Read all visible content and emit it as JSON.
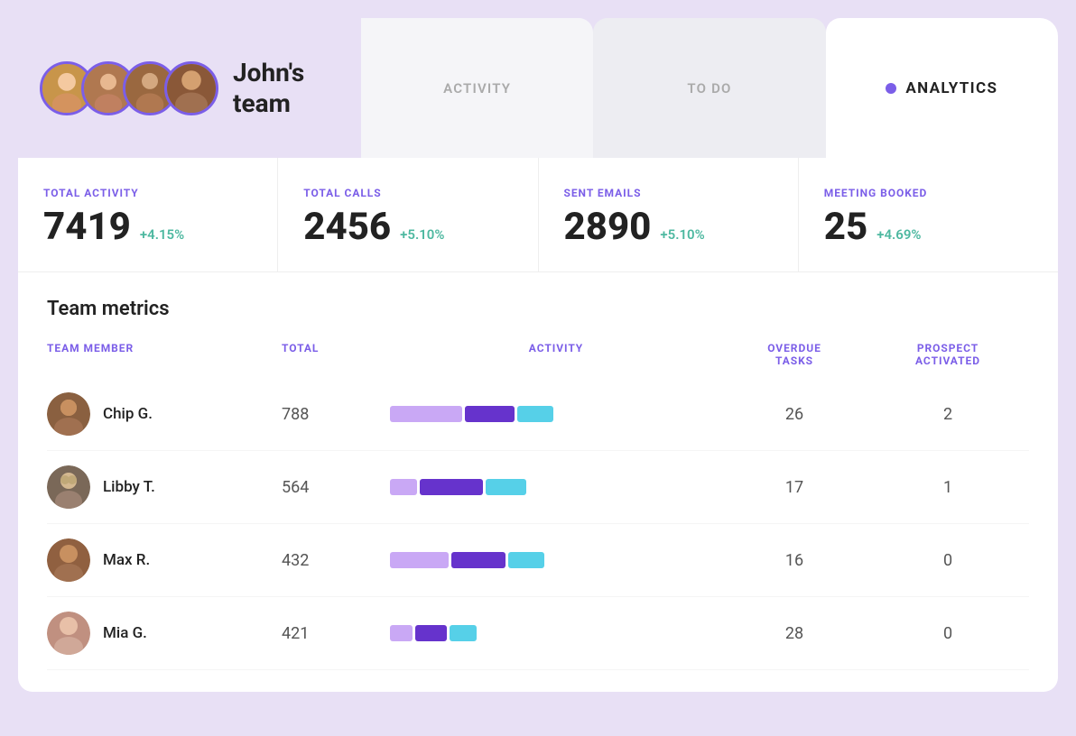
{
  "header": {
    "team_name": "John's\nteam",
    "team_name_line1": "John's",
    "team_name_line2": "team"
  },
  "tabs": [
    {
      "id": "activity",
      "label": "ACTIVITY",
      "active": false
    },
    {
      "id": "todo",
      "label": "TO DO",
      "active": false
    },
    {
      "id": "analytics",
      "label": "ANALYTICS",
      "active": true
    }
  ],
  "analytics_dot_color": "#7b5ee8",
  "stats": [
    {
      "label": "TOTAL ACTIVITY",
      "value": "7419",
      "change": "+4.15%"
    },
    {
      "label": "TOTAL CALLS",
      "value": "2456",
      "change": "+5.10%"
    },
    {
      "label": "SENT EMAILS",
      "value": "2890",
      "change": "+5.10%"
    },
    {
      "label": "MEETING BOOKED",
      "value": "25",
      "change": "+4.69%"
    }
  ],
  "team_metrics": {
    "section_title": "Team metrics",
    "columns": {
      "member": "TEAM MEMBER",
      "total": "TOTAL",
      "activity": "ACTIVITY",
      "overdue": "OVERDUE\nTASKS",
      "overdue_line1": "OVERDUE",
      "overdue_line2": "TASKS",
      "prospect": "PROSPECT\nACTIVATED",
      "prospect_line1": "PROSPECT",
      "prospect_line2": "ACTIVATED"
    },
    "rows": [
      {
        "id": "chip",
        "name": "Chip G.",
        "total": "788",
        "overdue_tasks": "26",
        "prospect_activated": "2",
        "bar": [
          {
            "type": "lavender",
            "width": 80
          },
          {
            "type": "purple",
            "width": 55
          },
          {
            "type": "cyan",
            "width": 40
          }
        ]
      },
      {
        "id": "libby",
        "name": "Libby T.",
        "total": "564",
        "overdue_tasks": "17",
        "prospect_activated": "1",
        "bar": [
          {
            "type": "lavender",
            "width": 30
          },
          {
            "type": "purple",
            "width": 70
          },
          {
            "type": "cyan",
            "width": 45
          }
        ]
      },
      {
        "id": "max",
        "name": "Max R.",
        "total": "432",
        "overdue_tasks": "16",
        "prospect_activated": "0",
        "bar": [
          {
            "type": "lavender",
            "width": 65
          },
          {
            "type": "purple",
            "width": 60
          },
          {
            "type": "cyan",
            "width": 40
          }
        ]
      },
      {
        "id": "mia",
        "name": "Mia G.",
        "total": "421",
        "overdue_tasks": "28",
        "prospect_activated": "0",
        "bar": [
          {
            "type": "lavender",
            "width": 25
          },
          {
            "type": "purple",
            "width": 35
          },
          {
            "type": "cyan",
            "width": 30
          }
        ]
      }
    ]
  }
}
